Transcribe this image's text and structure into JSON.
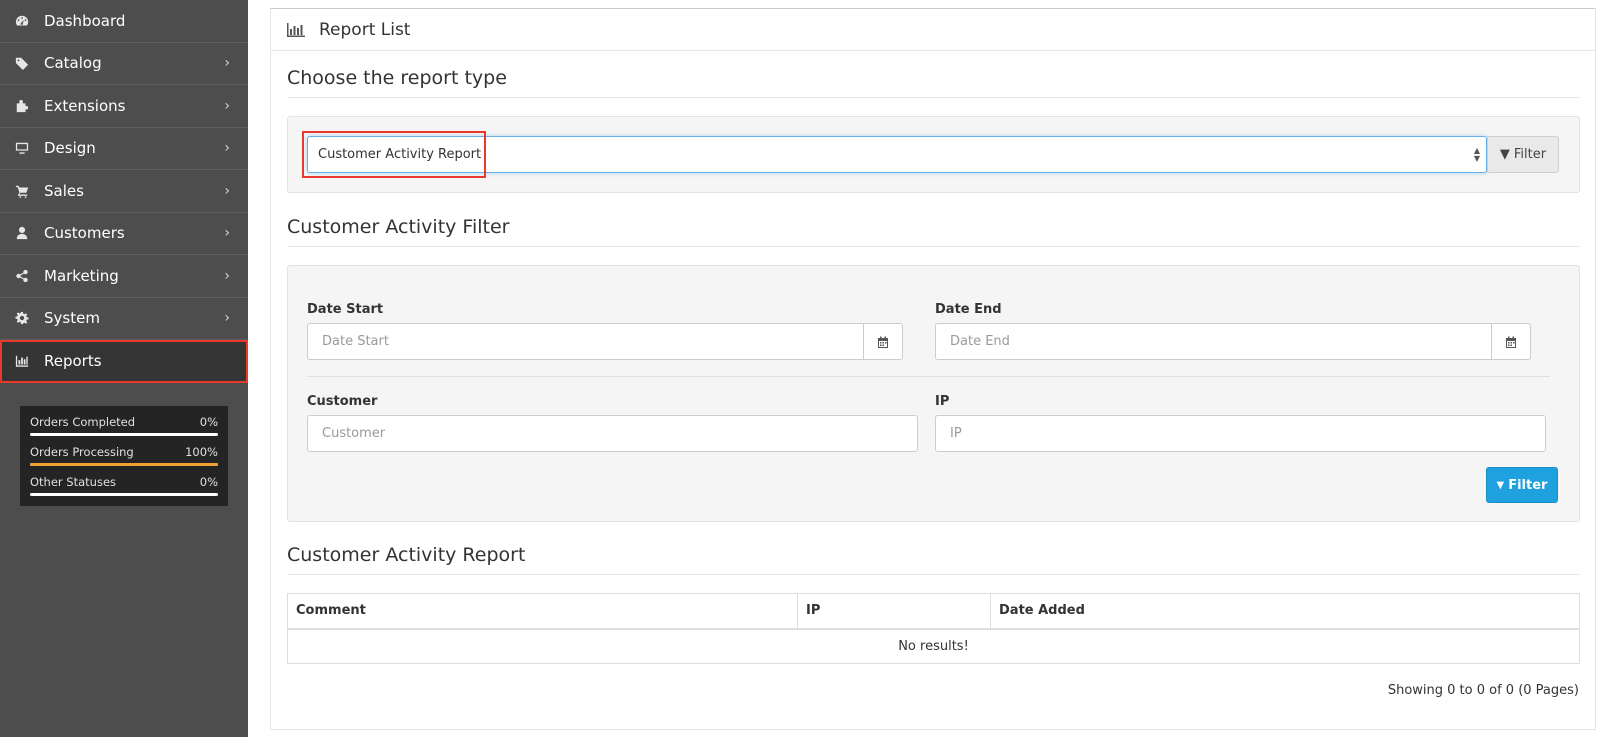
{
  "sidebar": {
    "items": [
      {
        "label": "Dashboard",
        "icon": "dashboard-icon",
        "has_children": false
      },
      {
        "label": "Catalog",
        "icon": "tags-icon",
        "has_children": true
      },
      {
        "label": "Extensions",
        "icon": "puzzle-icon",
        "has_children": true
      },
      {
        "label": "Design",
        "icon": "monitor-icon",
        "has_children": true
      },
      {
        "label": "Sales",
        "icon": "cart-icon",
        "has_children": true
      },
      {
        "label": "Customers",
        "icon": "user-icon",
        "has_children": true
      },
      {
        "label": "Marketing",
        "icon": "share-icon",
        "has_children": true
      },
      {
        "label": "System",
        "icon": "gear-icon",
        "has_children": true
      },
      {
        "label": "Reports",
        "icon": "bar-chart-icon",
        "has_children": false,
        "active": true
      }
    ],
    "stats": [
      {
        "label": "Orders Completed",
        "value": "0%",
        "fraction": 0,
        "color": "#ffffff"
      },
      {
        "label": "Orders Processing",
        "value": "100%",
        "fraction": 1,
        "color": "#f0a030"
      },
      {
        "label": "Other Statuses",
        "value": "0%",
        "fraction": 0,
        "color": "#ffffff"
      }
    ]
  },
  "panel": {
    "title": "Report List",
    "choose_title": "Choose the report type",
    "report_select": {
      "value": "Customer Activity Report"
    },
    "report_filter_label": "Filter"
  },
  "filter": {
    "title": "Customer Activity Filter",
    "date_start": {
      "label": "Date Start",
      "placeholder": "Date Start"
    },
    "date_end": {
      "label": "Date End",
      "placeholder": "Date End"
    },
    "customer": {
      "label": "Customer",
      "placeholder": "Customer"
    },
    "ip": {
      "label": "IP",
      "placeholder": "IP"
    },
    "button_label": "Filter"
  },
  "report": {
    "title": "Customer Activity Report",
    "columns": [
      "Comment",
      "IP",
      "Date Added"
    ],
    "empty_text": "No results!",
    "pagination": "Showing 0 to 0 of 0 (0 Pages)"
  },
  "colors": {
    "sidebar_bg": "#4d4d4d",
    "highlight": "#e8392a",
    "primary_button": "#1fa1e0",
    "processing_bar": "#f0a030"
  }
}
